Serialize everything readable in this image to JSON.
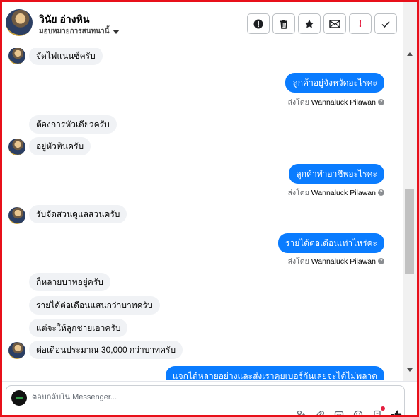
{
  "header": {
    "contact_name": "วินัย อ่างหิน",
    "assign_label": "มอบหมายการสนทนานี้"
  },
  "toolbar": {
    "buttons": [
      {
        "name": "spam",
        "icon": "exclamation-circle-icon"
      },
      {
        "name": "delete",
        "icon": "trash-icon"
      },
      {
        "name": "star",
        "icon": "star-icon"
      },
      {
        "name": "mark-unread",
        "icon": "envelope-icon"
      },
      {
        "name": "important",
        "icon": "exclamation-icon",
        "label": "!",
        "color": "#e41e3f"
      },
      {
        "name": "done",
        "icon": "check-icon"
      }
    ]
  },
  "messages": {
    "m1": "จัดไฟแนนซ์ครับ",
    "m2": "ลูกค้าอยู่จังหวัดอะไรคะ",
    "m3": "ต้องการหัวเดียวครับ",
    "m4": "อยู่หัวหินครับ",
    "m5": "ลูกค้าทำอาชีพอะไรคะ",
    "m6": "รับจัดสวนดูแลสวนครับ",
    "m7": "รายได้ต่อเดือนเท่าไหร่คะ",
    "m8": "ก็หลายบาทอยู่ครับ",
    "m9": "รายได้ต่อเดือนแสนกว่าบาทครับ",
    "m10": "แต่จะให้ลูกชายเอาครับ",
    "m11": "ต่อเดือนประมาณ 30,000 กว่าบาทครับ",
    "m12": "แจกได้หลายอย่างและส่งเราคุยเบอร์กันเลยจะได้ไม่พลาด"
  },
  "sent_by": {
    "prefix": "ส่งโดย",
    "name": "Wannaluck Pilawan"
  },
  "composer": {
    "placeholder": "ตอบกลับใน Messenger..."
  },
  "colors": {
    "outgoing_bubble": "#0a7cff",
    "incoming_bubble": "#f0f2f5",
    "frame_border": "#e8101a"
  }
}
